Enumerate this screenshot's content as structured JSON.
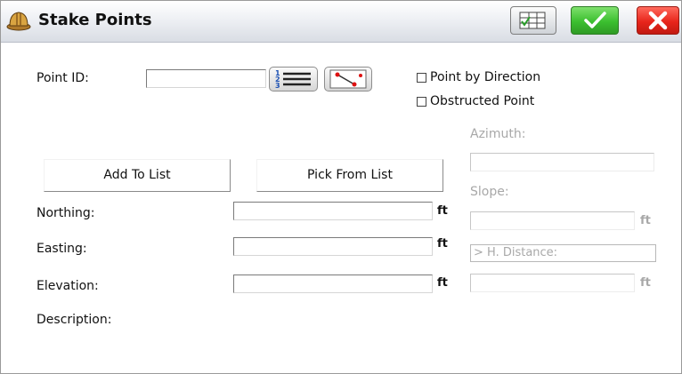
{
  "window": {
    "title": "Stake Points"
  },
  "titlebar": {
    "icons": [
      "hard-hat-icon",
      "point-list-icon",
      "checkmark-icon",
      "close-icon"
    ],
    "colors": {
      "ok": "#3bbf2f",
      "close": "#e8251b"
    }
  },
  "form": {
    "point_id": {
      "label": "Point ID:",
      "value": ""
    },
    "options": [
      {
        "label": "Point by Direction",
        "checked": false
      },
      {
        "label": "Obstructed Point",
        "checked": false
      }
    ],
    "add_to_list": "Add To List",
    "pick_from_list": "Pick From List",
    "northing": {
      "label": "Northing:",
      "value": "",
      "unit": "ft"
    },
    "easting": {
      "label": "Easting:",
      "value": "",
      "unit": "ft"
    },
    "elevation": {
      "label": "Elevation:",
      "value": "",
      "unit": "ft"
    },
    "description": {
      "label": "Description:"
    }
  },
  "direction": {
    "azimuth": {
      "label": "Azimuth:",
      "value": ""
    },
    "slope": {
      "label": "Slope:",
      "value": "",
      "unit": "ft"
    },
    "h_distance": {
      "label": "> H. Distance:",
      "value": "",
      "unit": "ft"
    }
  }
}
